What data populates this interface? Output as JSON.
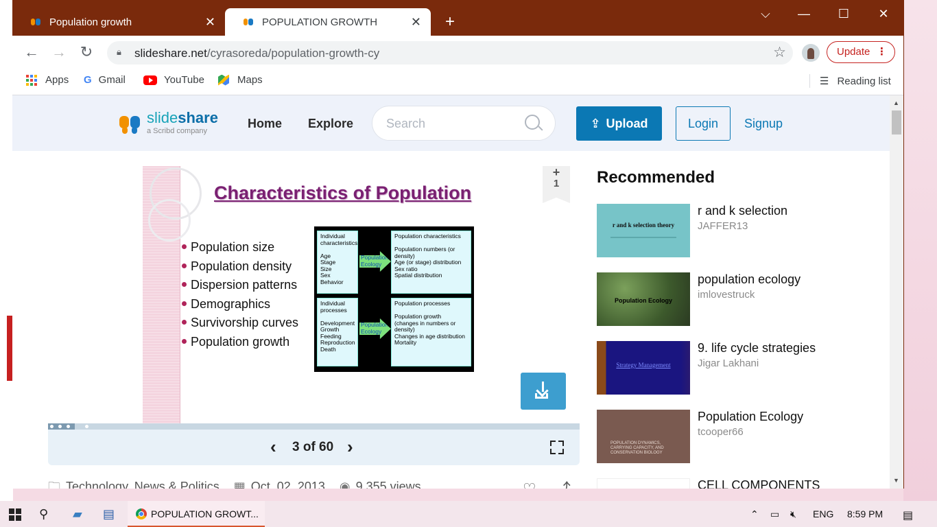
{
  "browser": {
    "tabs": [
      {
        "title": "Population growth",
        "active": false
      },
      {
        "title": "POPULATION GROWTH",
        "active": true
      }
    ],
    "new_tab_icon": "+",
    "url_host": "slideshare.net",
    "url_path": "/cyrasoreda/population-growth-cy",
    "update_label": "Update",
    "bookmarks": [
      "Apps",
      "Gmail",
      "YouTube",
      "Maps"
    ],
    "reading_list_label": "Reading list"
  },
  "site": {
    "logo_text_a": "slide",
    "logo_text_b": "share",
    "logo_sub": "a Scribd company",
    "nav_home": "Home",
    "nav_explore": "Explore",
    "search_placeholder": "Search",
    "upload_label": "Upload",
    "login_label": "Login",
    "signup_label": "Signup",
    "brand_color": "#0b78b4"
  },
  "slide": {
    "title": "Characteristics of Population",
    "bullets": [
      "Population size",
      "Population density",
      "Dispersion patterns",
      "Demographics",
      "Survivorship curves",
      "Population growth"
    ],
    "diagram": {
      "box1": "Individual characteristics\n\nAge\nStage\nSize\nSex\nBehavior",
      "box2": "Population characteristics\n\nPopulation numbers (or density)\nAge (or stage) distribution\nSex ratio\nSpatial distribution",
      "box3": "Individual processes\n\nDevelopment\nGrowth\nFeeding\nReproduction\nDeath",
      "box4": "Population processes\n\nPopulation growth\n(changes in numbers or density)\nChanges in age distribution\nMortality",
      "arrow_label": "Population Ecology"
    },
    "clip_plus": "+",
    "clip_count": "1",
    "page_label": "3 of 60",
    "current_page": 3,
    "total_pages": 60
  },
  "meta": {
    "category": "Technology, News & Politics",
    "date": "Oct. 02, 2013",
    "views": "9,355 views"
  },
  "recommended": {
    "title": "Recommended",
    "items": [
      {
        "title": "r and k selection",
        "author": "JAFFER13",
        "thumb_text": "r and k selection theory"
      },
      {
        "title": "population ecology",
        "author": "imlovestruck",
        "thumb_text": "Population Ecology"
      },
      {
        "title": "9. life cycle strategies",
        "author": "Jigar Lakhani",
        "thumb_text": "Strategy Management"
      },
      {
        "title": "Population Ecology",
        "author": "tcooper66",
        "thumb_text": "POPULATION DYNAMICS, CARRYING CAPACITY, AND CONSERVATION BIOLOGY"
      },
      {
        "title": "CELL COMPONENTS",
        "author": "",
        "thumb_text": ""
      }
    ]
  },
  "taskbar": {
    "task_label": "POPULATION GROWT...",
    "lang": "ENG",
    "time": "8:59 PM"
  }
}
